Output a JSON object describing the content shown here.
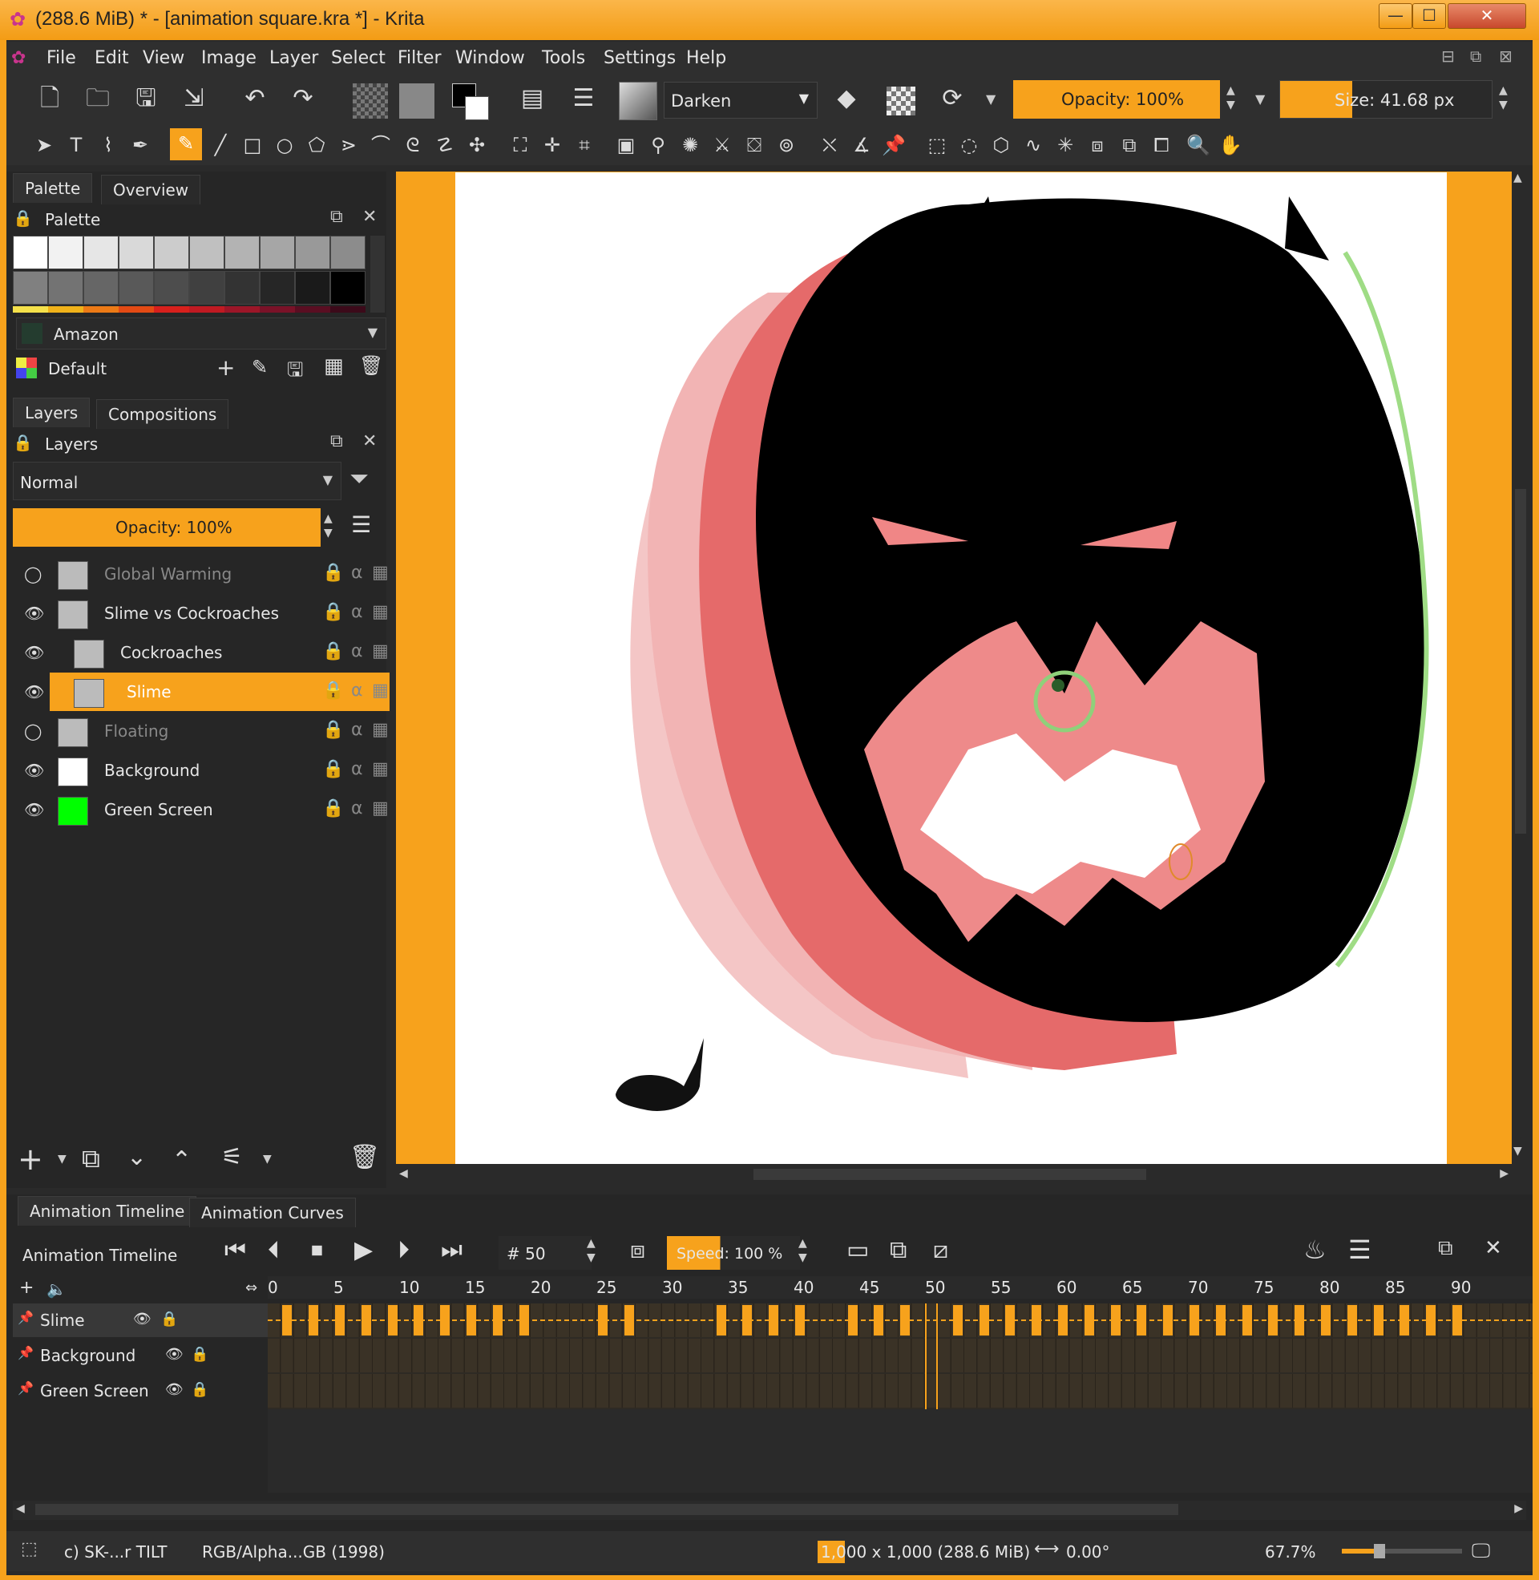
{
  "window": {
    "title": "(288.6 MiB)  * - [animation square.kra *] - Krita",
    "minimize": "—",
    "maximize": "☐",
    "close": "✕"
  },
  "menu": [
    "File",
    "Edit",
    "View",
    "Image",
    "Layer",
    "Select",
    "Filter",
    "Window",
    "Tools",
    "Settings",
    "Help"
  ],
  "toolbar": {
    "blend_mode": "Darken",
    "opacity": "Opacity: 100%",
    "size": "Size: 41.68 px"
  },
  "palette_dock": {
    "tabs": [
      "Palette",
      "Overview"
    ],
    "title": "Palette",
    "swatch_rows": [
      [
        "#ffffff",
        "#f2f2f2",
        "#e6e6e6",
        "#d9d9d9",
        "#cccccc",
        "#c0c0c0",
        "#b3b3b3",
        "#a6a6a6",
        "#999999",
        "#8c8c8c"
      ],
      [
        "#808080",
        "#737373",
        "#666666",
        "#595959",
        "#4d4d4d",
        "#404040",
        "#333333",
        "#262626",
        "#1a1a1a",
        "#000000"
      ]
    ],
    "accent_strip": [
      "#f5e14a",
      "#f0b21a",
      "#ec7a16",
      "#e34a14",
      "#d8201c",
      "#c01a22",
      "#9c1628",
      "#7a1228",
      "#5a0e22",
      "#3c0a1a"
    ],
    "selected_palette": "Amazon",
    "palette_set": "Default"
  },
  "layers_dock": {
    "tabs": [
      "Layers",
      "Compositions"
    ],
    "title": "Layers",
    "blend_mode": "Normal",
    "opacity": "Opacity:  100%",
    "layers": [
      {
        "name": "Global Warming",
        "visible": false,
        "selected": false,
        "dim": true
      },
      {
        "name": "Slime vs Cockroaches",
        "visible": true,
        "selected": false,
        "dim": false
      },
      {
        "name": "Cockroaches",
        "visible": true,
        "selected": false,
        "dim": false
      },
      {
        "name": "Slime",
        "visible": true,
        "selected": true,
        "dim": false
      },
      {
        "name": "Floating",
        "visible": false,
        "selected": false,
        "dim": true
      },
      {
        "name": "Background",
        "visible": true,
        "selected": false,
        "dim": false
      },
      {
        "name": "Green Screen",
        "visible": true,
        "selected": false,
        "dim": false
      }
    ]
  },
  "timeline": {
    "tabs": [
      "Animation Timeline",
      "Animation Curves"
    ],
    "title": "Animation Timeline",
    "frame": "# 50",
    "speed": "Speed: 100 %",
    "ticks": [
      "0",
      "5",
      "10",
      "15",
      "20",
      "25",
      "30",
      "35",
      "40",
      "45",
      "50",
      "55",
      "60",
      "65",
      "70",
      "75",
      "80",
      "85",
      "90"
    ],
    "current_frame": 50,
    "tracks": [
      "Slime",
      "Background",
      "Green Screen"
    ],
    "keyframes": [
      1,
      3,
      5,
      7,
      9,
      11,
      13,
      15,
      17,
      19,
      25,
      27,
      34,
      36,
      38,
      40,
      44,
      46,
      48,
      52,
      54,
      56,
      58,
      60,
      62,
      64,
      66,
      68,
      70,
      72,
      74,
      76,
      78,
      80,
      82,
      84,
      86,
      88,
      90
    ]
  },
  "status": {
    "tool": "c) SK-...r TILT",
    "colorspace": "RGB/Alpha...GB (1998)",
    "dimensions": "1,000 x 1,000 (288.6 MiB)",
    "rotation": "0.00°",
    "zoom": "67.7%"
  },
  "colors": {
    "accent": "#f7a21c",
    "panel": "#262626",
    "canvas_bg": "#ffffff"
  }
}
